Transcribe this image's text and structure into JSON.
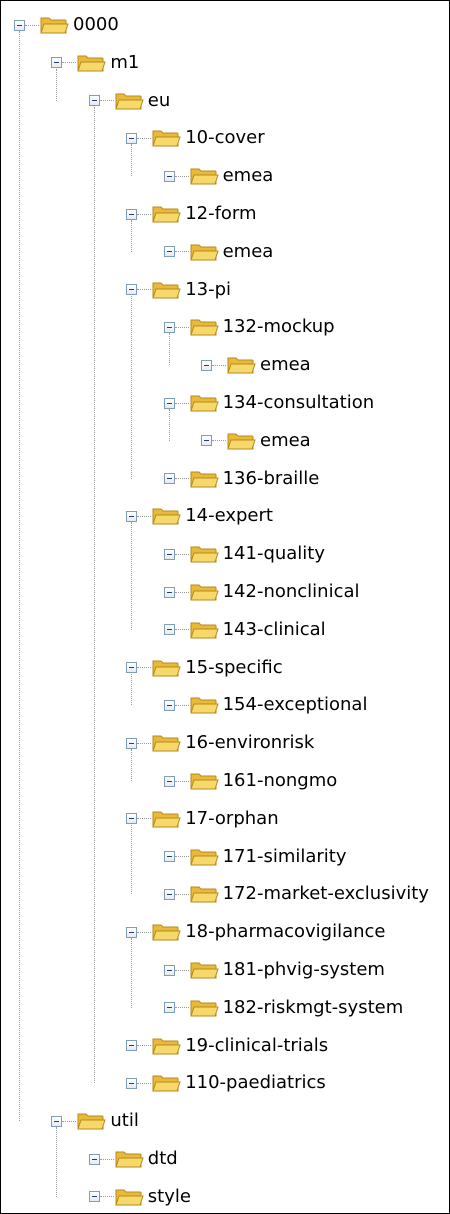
{
  "tree": {
    "label": "0000",
    "icon": "folder-icon",
    "children": [
      {
        "label": "m1",
        "icon": "folder-icon",
        "children": [
          {
            "label": "eu",
            "icon": "folder-icon",
            "children": [
              {
                "label": "10-cover",
                "icon": "folder-icon",
                "children": [
                  {
                    "label": "emea",
                    "icon": "folder-icon"
                  }
                ]
              },
              {
                "label": "12-form",
                "icon": "folder-icon",
                "children": [
                  {
                    "label": "emea",
                    "icon": "folder-icon"
                  }
                ]
              },
              {
                "label": "13-pi",
                "icon": "folder-icon",
                "children": [
                  {
                    "label": "132-mockup",
                    "icon": "folder-icon",
                    "children": [
                      {
                        "label": "emea",
                        "icon": "folder-icon"
                      }
                    ]
                  },
                  {
                    "label": "134-consultation",
                    "icon": "folder-icon",
                    "children": [
                      {
                        "label": "emea",
                        "icon": "folder-icon"
                      }
                    ]
                  },
                  {
                    "label": "136-braille",
                    "icon": "folder-icon"
                  }
                ]
              },
              {
                "label": "14-expert",
                "icon": "folder-icon",
                "children": [
                  {
                    "label": "141-quality",
                    "icon": "folder-icon"
                  },
                  {
                    "label": "142-nonclinical",
                    "icon": "folder-icon"
                  },
                  {
                    "label": "143-clinical",
                    "icon": "folder-icon"
                  }
                ]
              },
              {
                "label": "15-specific",
                "icon": "folder-icon",
                "children": [
                  {
                    "label": "154-exceptional",
                    "icon": "folder-icon"
                  }
                ]
              },
              {
                "label": "16-environrisk",
                "icon": "folder-icon",
                "children": [
                  {
                    "label": "161-nongmo",
                    "icon": "folder-icon"
                  }
                ]
              },
              {
                "label": "17-orphan",
                "icon": "folder-icon",
                "children": [
                  {
                    "label": "171-similarity",
                    "icon": "folder-icon"
                  },
                  {
                    "label": "172-market-exclusivity",
                    "icon": "folder-icon"
                  }
                ]
              },
              {
                "label": "18-pharmacovigilance",
                "icon": "folder-icon",
                "children": [
                  {
                    "label": "181-phvig-system",
                    "icon": "folder-icon"
                  },
                  {
                    "label": "182-riskmgt-system",
                    "icon": "folder-icon"
                  }
                ]
              },
              {
                "label": "19-clinical-trials",
                "icon": "folder-icon"
              },
              {
                "label": "110-paediatrics",
                "icon": "folder-icon"
              }
            ]
          }
        ]
      },
      {
        "label": "util",
        "icon": "folder-icon",
        "children": [
          {
            "label": "dtd",
            "icon": "folder-icon"
          },
          {
            "label": "style",
            "icon": "folder-icon"
          }
        ]
      }
    ]
  },
  "colors": {
    "toggle_border": "#7f9db9",
    "toggle_sign": "#1f3f7a",
    "connector": "#9a9a9a",
    "folder_fill": "#f6d86b",
    "folder_tab": "#e9b93a",
    "folder_outline": "#b88a1c",
    "text": "#000000"
  }
}
